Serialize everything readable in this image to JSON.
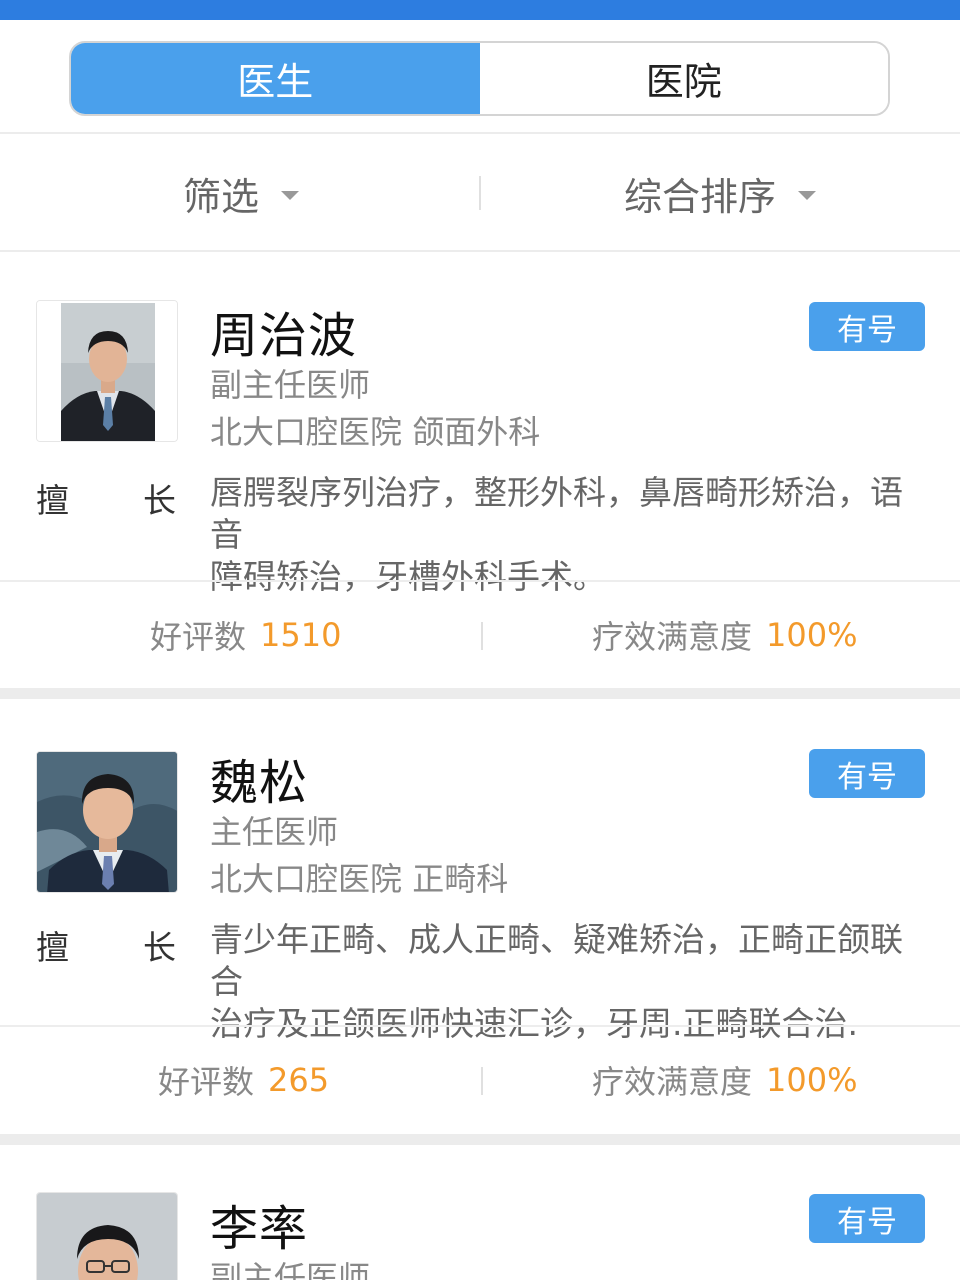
{
  "tabs": {
    "doctor_label": "医生",
    "hospital_label": "医院"
  },
  "filters": {
    "filter_label": "筛选",
    "sort_label": "综合排序"
  },
  "doctors": [
    {
      "name": "周治波",
      "title": "副主任医师",
      "hospital": "北大口腔医院",
      "department": "颌面外科",
      "badge": "有号",
      "specialty_label_1": "擅",
      "specialty_label_2": "长",
      "specialty_line1": "唇腭裂序列治疗，整形外科，鼻唇畸形矫治，语音",
      "specialty_line2": "障碍矫治，牙槽外科手术。",
      "reviews_label": "好评数",
      "reviews_count": "1510",
      "satisfaction_label": "疗效满意度",
      "satisfaction_value": "100%"
    },
    {
      "name": "魏松",
      "title": "主任医师",
      "hospital": "北大口腔医院",
      "department": "正畸科",
      "badge": "有号",
      "specialty_label_1": "擅",
      "specialty_label_2": "长",
      "specialty_line1": "青少年正畸、成人正畸、疑难矫治，正畸正颌联合",
      "specialty_line2": "治疗及正颌医师快速汇诊，牙周.正畸联合治.",
      "reviews_label": "好评数",
      "reviews_count": "265",
      "satisfaction_label": "疗效满意度",
      "satisfaction_value": "100%"
    },
    {
      "name": "李率",
      "title": "副主任医师",
      "badge": "有号"
    }
  ],
  "colors": {
    "accent": "#4aa0ec",
    "top_bar": "#2d7de0",
    "number": "#f39a2b"
  }
}
